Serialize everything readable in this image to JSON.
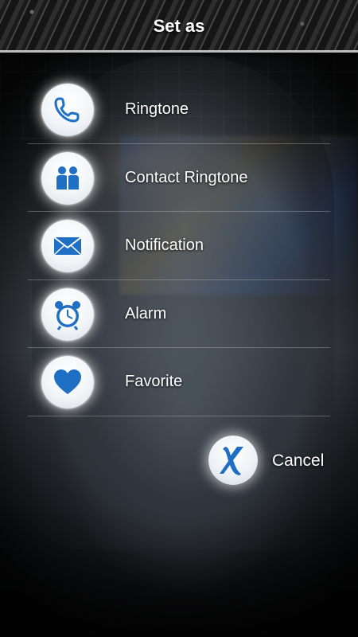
{
  "header": {
    "title": "Set as"
  },
  "menu": {
    "items": [
      {
        "label": "Ringtone",
        "icon": "phone-icon"
      },
      {
        "label": "Contact Ringtone",
        "icon": "contacts-icon"
      },
      {
        "label": "Notification",
        "icon": "envelope-icon"
      },
      {
        "label": "Alarm",
        "icon": "alarm-clock-icon"
      },
      {
        "label": "Favorite",
        "icon": "heart-icon"
      }
    ]
  },
  "cancel": {
    "label": "Cancel",
    "icon": "close-x-icon"
  },
  "colors": {
    "icon_blue": "#1f6fc4",
    "icon_bg": "#f4f6f8",
    "text": "#ffffff"
  }
}
